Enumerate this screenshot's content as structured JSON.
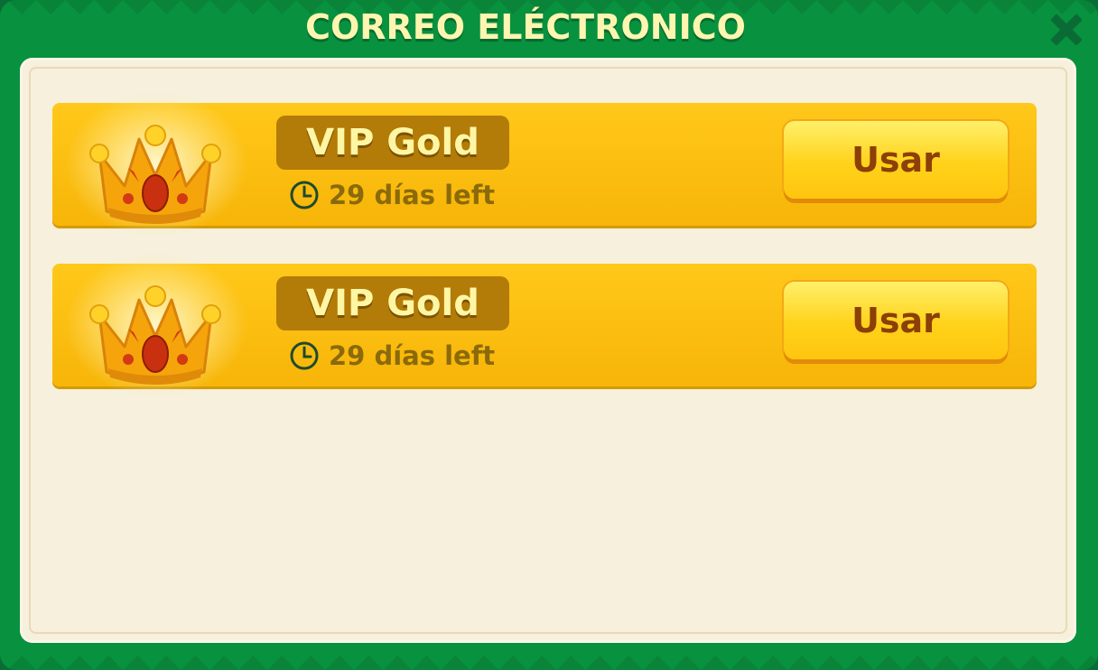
{
  "dialog": {
    "title": "CORREO ELÉCTRONICO",
    "close_icon": "close-x-icon"
  },
  "colors": {
    "frame_green": "#08913f",
    "panel_cream": "#f6f0dc",
    "item_gold": "#ffc81a",
    "button_yellow": "#ffd21a",
    "button_text": "#8c3f06",
    "title_text": "#fdf5b0"
  },
  "mail_items": [
    {
      "icon": "crown-icon",
      "name": "VIP Gold",
      "time_icon": "clock-icon",
      "time_left": "29 días left",
      "button_label": "Usar"
    },
    {
      "icon": "crown-icon",
      "name": "VIP Gold",
      "time_icon": "clock-icon",
      "time_left": "29 días left",
      "button_label": "Usar"
    }
  ]
}
